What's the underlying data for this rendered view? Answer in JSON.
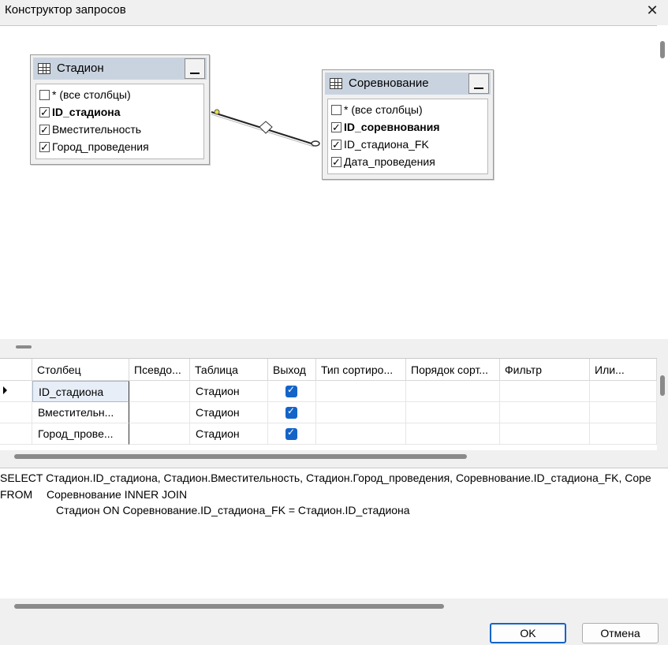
{
  "window": {
    "title": "Конструктор запросов",
    "close_glyph": "✕"
  },
  "diagram": {
    "tables": [
      {
        "name": "Стадион",
        "columns": [
          {
            "label": "* (все столбцы)",
            "checked": false,
            "bold": false
          },
          {
            "label": "ID_стадиона",
            "checked": true,
            "bold": true
          },
          {
            "label": "Вместительность",
            "checked": true,
            "bold": false
          },
          {
            "label": "Город_проведения",
            "checked": true,
            "bold": false
          }
        ]
      },
      {
        "name": "Соревнование",
        "columns": [
          {
            "label": "* (все столбцы)",
            "checked": false,
            "bold": false
          },
          {
            "label": "ID_соревнования",
            "checked": true,
            "bold": true
          },
          {
            "label": "ID_стадиона_FK",
            "checked": true,
            "bold": false
          },
          {
            "label": "Дата_проведения",
            "checked": true,
            "bold": false
          }
        ]
      }
    ]
  },
  "grid": {
    "headers": [
      "Столбец",
      "Псевдо...",
      "Таблица",
      "Выход",
      "Тип сортиро...",
      "Порядок сорт...",
      "Фильтр",
      "Или..."
    ],
    "rows": [
      {
        "column": "ID_стадиона",
        "alias": "",
        "table": "Стадион",
        "output": true,
        "current": true
      },
      {
        "column": "Вместительн...",
        "alias": "",
        "table": "Стадион",
        "output": true,
        "current": false
      },
      {
        "column": "Город_прове...",
        "alias": "",
        "table": "Стадион",
        "output": true,
        "current": false
      }
    ]
  },
  "sql": {
    "lines": [
      "SELECT Стадион.ID_стадиона, Стадион.Вместительность, Стадион.Город_проведения, Соревнование.ID_стадиона_FK, Соре",
      "FROM",
      "Соревнование INNER JOIN",
      "Стадион ON Соревнование.ID_стадиона_FK = Стадион.ID_стадиона"
    ]
  },
  "buttons": {
    "ok": "OK",
    "cancel": "Отмена"
  }
}
